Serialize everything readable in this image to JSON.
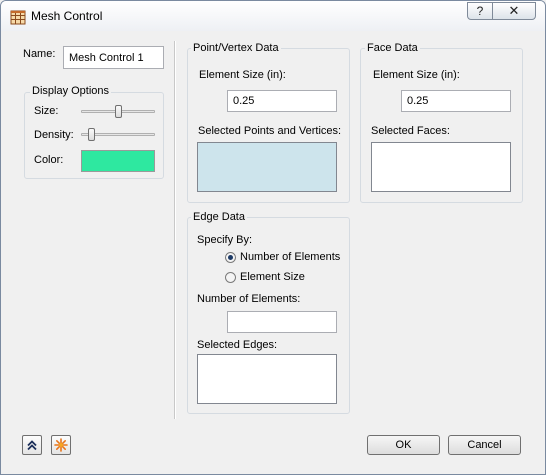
{
  "window": {
    "title": "Mesh Control",
    "icon": "mesh-grid-icon",
    "help_glyph": "?",
    "close_glyph": "✕"
  },
  "name_field": {
    "label": "Name:",
    "value": "Mesh Control 1"
  },
  "display_options": {
    "title": "Display Options",
    "size_label": "Size:",
    "size_level": 0.5,
    "density_label": "Density:",
    "density_level": 0.1,
    "color_label": "Color:",
    "color_value": "#2ee8a0"
  },
  "point_vertex": {
    "title": "Point/Vertex Data",
    "element_size_label": "Element Size (in):",
    "element_size_value": "0.25",
    "selected_label": "Selected Points and Vertices:",
    "selection_color": "#cde4ec"
  },
  "face_data": {
    "title": "Face Data",
    "element_size_label": "Element Size (in):",
    "element_size_value": "0.25",
    "selected_label": "Selected Faces:"
  },
  "edge_data": {
    "title": "Edge Data",
    "specify_label": "Specify By:",
    "options": [
      "Number of Elements",
      "Element Size"
    ],
    "selected_option": "Number of Elements",
    "num_elements_label": "Number of Elements:",
    "num_elements_value": "",
    "selected_label": "Selected Edges:"
  },
  "footer": {
    "ok_label": "OK",
    "cancel_label": "Cancel",
    "expand_icon": "double-chevron-up-icon",
    "new_icon": "starburst-icon"
  }
}
